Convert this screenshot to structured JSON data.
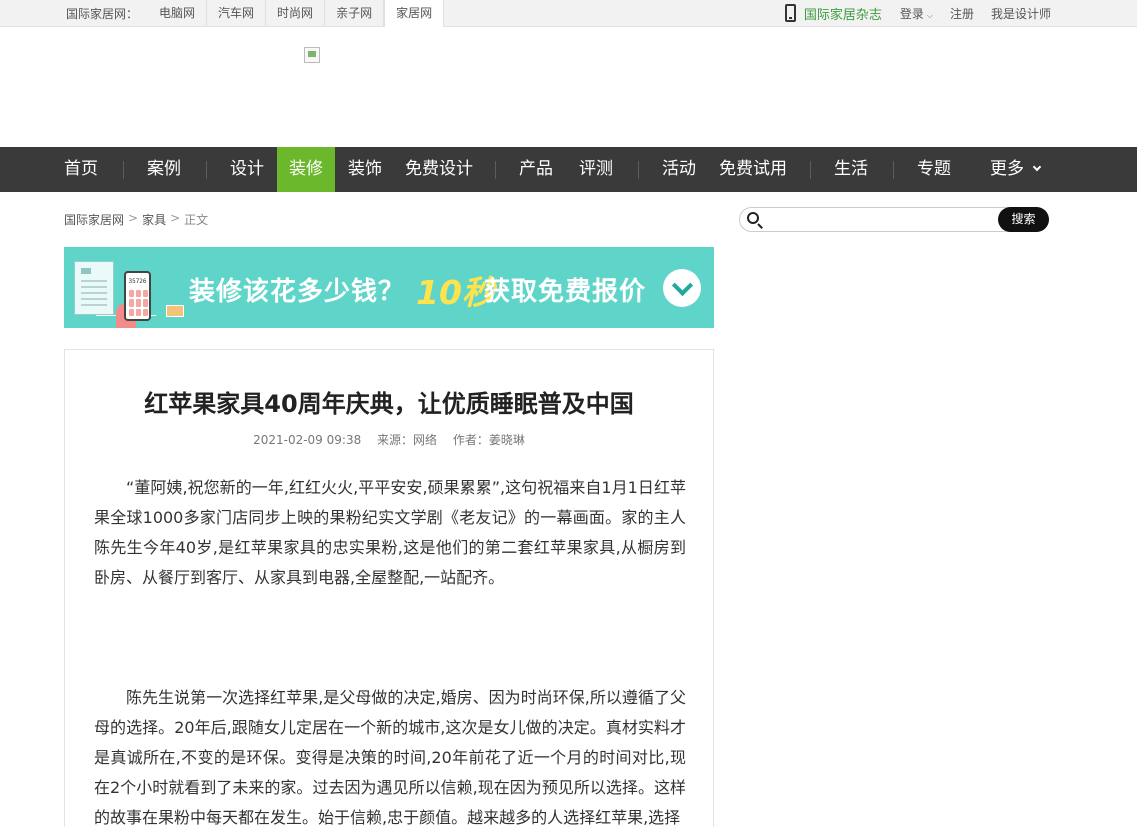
{
  "topbar": {
    "group_label": "国际家居网：",
    "sites": [
      "电脑网",
      "汽车网",
      "时尚网",
      "亲子网",
      "家居网"
    ],
    "active_site": "家居网",
    "magazine": "国际家居杂志",
    "login": "登录",
    "register": "注册",
    "designer": "我是设计师"
  },
  "nav": {
    "items": [
      "首页",
      "案例",
      "设计",
      "装修",
      "装饰",
      "免费设计",
      "产品",
      "评测",
      "活动",
      "免费试用",
      "生活",
      "专题",
      "更多"
    ],
    "active": "装修"
  },
  "breadcrumb": {
    "home": "国际家居网",
    "sep": ">",
    "category": "家具",
    "current": "正文"
  },
  "search": {
    "placeholder": "",
    "button": "搜索"
  },
  "banner": {
    "calc_number": "35726",
    "text_part1": "装修该花多少钱？",
    "text_highlight": "10秒",
    "text_part2": "获取免费报价"
  },
  "article": {
    "title": "红苹果家具40周年庆典，让优质睡眠普及中国",
    "date": "2021-02-09 09:38",
    "source": "来源：网络",
    "author": "作者：姜晓琳",
    "paragraphs": [
      "“董阿姨,祝您新的一年,红红火火,平平安安,硕果累累”,这句祝福来自1月1日红苹果全球1000多家门店同步上映的果粉纪实文学剧《老友记》的一幕画面。家的主人陈先生今年40岁,是红苹果家具的忠实果粉,这是他们的第二套红苹果家具,从橱房到卧房、从餐厅到客厅、从家具到电器,全屋整配,一站配齐。",
      "陈先生说第一次选择红苹果,是父母做的决定,婚房、因为时尚环保,所以遵循了父母的选择。20年后,跟随女儿定居在一个新的城市,这次是女儿做的决定。真材实料才是真诚所在,不变的是环保。变得是决策的时间,20年前花了近一个月的时间对比,现在2个小时就看到了未来的家。过去因为遇见所以信赖,现在因为预见所以选择。这样的故事在果粉中每天都在发生。始于信赖,忠于颜值。越来越多的人选择红苹果,选择"
    ]
  }
}
